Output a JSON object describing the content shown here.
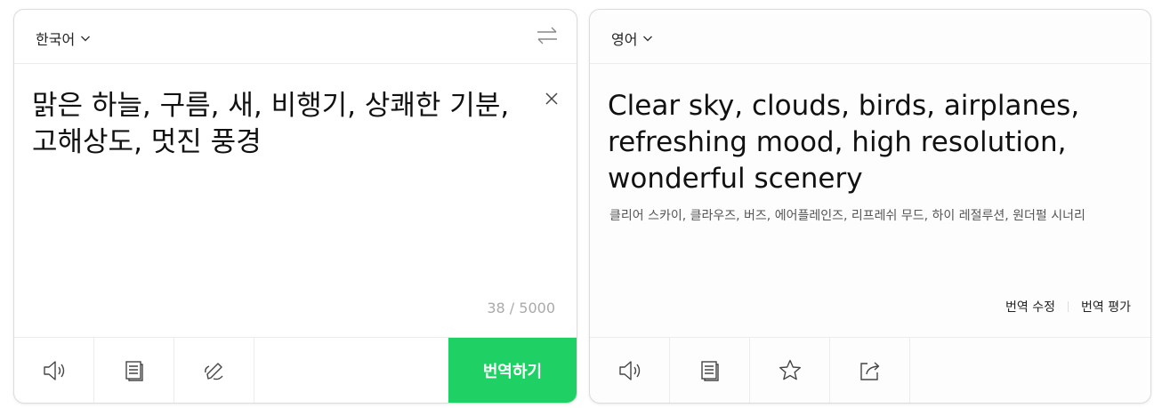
{
  "source": {
    "language": "한국어",
    "text": "맑은 하늘, 구름, 새, 비행기, 상쾌한 기분, 고해상도, 멋진 풍경",
    "char_count": "38 / 5000",
    "translate_button": "번역하기"
  },
  "target": {
    "language": "영어",
    "text": "Clear sky, clouds, birds, airplanes, refreshing mood, high resolution, wonderful scenery",
    "pronunciation": "클리어 스카이, 클라우즈, 버즈, 에어플레인즈, 리프레쉬 무드, 하이 레절루션, 원더펄 시너리",
    "edit_link": "번역 수정",
    "rate_link": "번역 평가"
  },
  "accent_color": "#1fd165"
}
